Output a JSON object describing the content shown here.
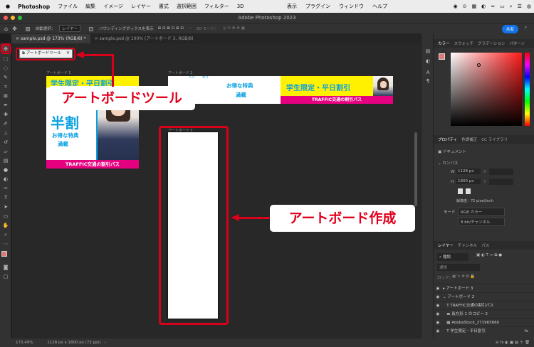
{
  "menubar": {
    "apple": "",
    "app": "Photoshop",
    "items": [
      "ファイル",
      "編集",
      "イメージ",
      "レイヤー",
      "書式",
      "選択範囲",
      "フィルター",
      "3D"
    ],
    "items_right": [
      "表示",
      "プラグイン",
      "ウィンドウ",
      "ヘルプ"
    ]
  },
  "window": {
    "title": "Adobe Photoshop 2023"
  },
  "options": {
    "auto_select_label": "自動選択：",
    "auto_select_value": "レイヤー",
    "bbox_label": "バウンディングボックスを表示",
    "mode_3d": "3D モード：",
    "share": "共有"
  },
  "tabs": [
    {
      "label": "sample.psd @ 173% (RGB/8) *"
    },
    {
      "label": "sample.psd @ 100% (アートボード 3, RGB/8)"
    }
  ],
  "tooltip": {
    "label": "アートボードツール",
    "shortcut": "V"
  },
  "artboards": {
    "a1": "アートボード 1",
    "a2": "アートボード 2",
    "a3": "アートボード 3"
  },
  "banner": {
    "top_text": "学生限定・平日割引",
    "big": "半割",
    "ruby1": "へい",
    "ruby2": "わり",
    "sub1": "お得な特典",
    "sub2": "満載",
    "bottom": "TRAFFIC交通の割引パス",
    "banner2_title": "学生限定・平日割引",
    "banner2_bottom": "TRAFFIC交通の割引パス"
  },
  "callouts": {
    "tool": "アートボードツール",
    "create": "アートボード作成"
  },
  "status": {
    "zoom": "173.49%",
    "info": "1128 px x 1800 px (72 ppi)"
  },
  "color_panel": {
    "tabs": [
      "カラー",
      "スウォッチ",
      "グラデーション",
      "パターン"
    ]
  },
  "properties": {
    "tabs": [
      "プロパティ",
      "色調補正",
      "CC ライブラリ"
    ],
    "type": "ドキュメント",
    "canvas": "カンバス",
    "w_label": "W",
    "w": "1128 px",
    "h_label": "H",
    "h": "1800 px",
    "x_label": "X",
    "y_label": "Y",
    "resolution": "解像度：72 pixel/inch",
    "mode_label": "モード",
    "mode": "RGB カラー",
    "depth": "8 bit/チャンネル"
  },
  "layers": {
    "tabs": [
      "レイヤー",
      "チャンネル",
      "パス"
    ],
    "kind": "種類",
    "blend": "通常",
    "lock": "ロック：",
    "items": [
      {
        "name": "アートボード 3"
      },
      {
        "name": "アートボード 2"
      },
      {
        "name": "TRAFFIC交通の割引パス"
      },
      {
        "name": "長方形 1 のコピー 2"
      },
      {
        "name": "AdobeStock_271965660"
      },
      {
        "name": "学生限定・平日割引"
      }
    ]
  },
  "colors": {
    "accent": "#d9001b",
    "banner_blue": "#0aa1e2",
    "banner_pink": "#e4007f",
    "banner_yellow": "#fff100"
  }
}
